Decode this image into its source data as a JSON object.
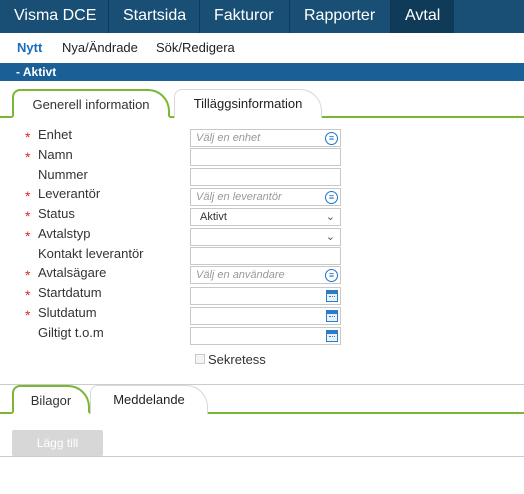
{
  "topnav": {
    "items": [
      {
        "label": "Visma DCE"
      },
      {
        "label": "Startsida"
      },
      {
        "label": "Fakturor"
      },
      {
        "label": "Rapporter"
      },
      {
        "label": "Avtal"
      }
    ]
  },
  "subnav": {
    "items": [
      {
        "label": "Nytt"
      },
      {
        "label": "Nya/Ändrade"
      },
      {
        "label": "Sök/Redigera"
      }
    ]
  },
  "section": {
    "title": "- Aktivt"
  },
  "tabs_top": [
    {
      "label": "Generell information"
    },
    {
      "label": "Tilläggsinformation"
    }
  ],
  "form": {
    "required_marker": "*",
    "fields": [
      {
        "label": "Enhet",
        "placeholder": "Välj en enhet",
        "value": ""
      },
      {
        "label": "Namn",
        "value": ""
      },
      {
        "label": "Nummer",
        "value": ""
      },
      {
        "label": "Leverantör",
        "placeholder": "Välj en leverantör",
        "value": ""
      },
      {
        "label": "Status",
        "value": "Aktivt"
      },
      {
        "label": "Avtalstyp",
        "value": ""
      },
      {
        "label": "Kontakt leverantör",
        "value": ""
      },
      {
        "label": "Avtalsägare",
        "placeholder": "Välj en användare",
        "value": ""
      },
      {
        "label": "Startdatum",
        "value": ""
      },
      {
        "label": "Slutdatum",
        "value": ""
      },
      {
        "label": "Giltigt t.o.m",
        "value": ""
      }
    ],
    "secret_label": "Sekretess",
    "secret_checked": false
  },
  "tabs_bottom": [
    {
      "label": "Bilagor"
    },
    {
      "label": "Meddelande"
    }
  ],
  "attachments": {
    "add_label": "Lägg till"
  },
  "icons": {
    "picker": "list-picker-icon",
    "calendar": "calendar-icon",
    "dropdown": "chevron-down-icon"
  },
  "colors": {
    "nav": "#1a4f75",
    "nav_active": "#0f3a58",
    "section_bar": "#1a5f96",
    "tab_accent": "#7ab733",
    "required": "#d9282e",
    "link_active": "#1a6cc1"
  }
}
